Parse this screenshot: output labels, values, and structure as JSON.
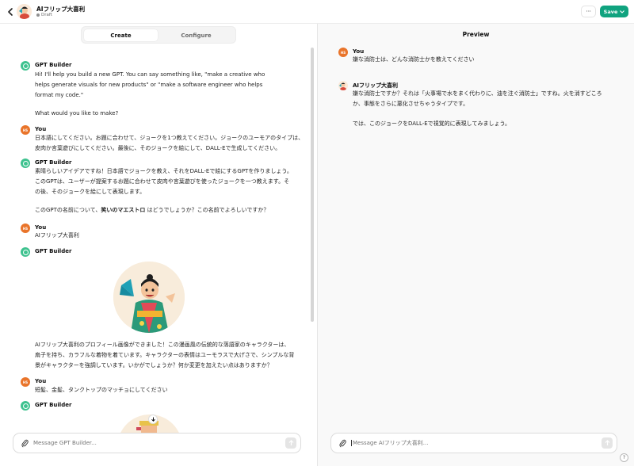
{
  "header": {
    "gpt_name": "AIフリップ大喜利",
    "status": "Draft",
    "more_label": "···",
    "save_label": "Save"
  },
  "tabs": [
    {
      "label": "Create",
      "active": true
    },
    {
      "label": "Configure",
      "active": false
    }
  ],
  "builder_chat": {
    "messages": [
      {
        "sender": "GPT Builder",
        "lines": [
          "Hi! I'll help you build a new GPT. You can say something like, \"make a creative who",
          "helps generate visuals for new products\" or \"make a software engineer who helps",
          "format my code.\""
        ],
        "extra": "What would you like to make?"
      },
      {
        "sender": "You",
        "lines": [
          "日本語にしてください。お題に合わせて、ジョークを1つ教えてください。ジョークのユーモアのタイプは、",
          "皮肉か言葉遊びにしてください。最後に、そのジョークを絵にして、DALL-Eで生成してください。"
        ]
      },
      {
        "sender": "GPT Builder",
        "lines": [
          "素晴らしいアイデアですね！日本語でジョークを教え、それをDALL-Eで絵にするGPTを作りましょう。",
          "このGPTは、ユーザーが提案するお題に合わせて皮肉や言葉遊びを使ったジョークを一つ教えます。そ",
          "の後、そのジョークを絵にして表現します。"
        ],
        "extra_prefix": "このGPTの名前について、",
        "extra_bold": "笑いのマエストロ",
        "extra_suffix": " はどうでしょうか？この名前でよろしいですか？"
      },
      {
        "sender": "You",
        "lines": [
          "AIフリップ大喜利"
        ]
      },
      {
        "sender": "GPT Builder",
        "lines": [
          "AIフリップ大喜利のプロフィール画像ができました！この漫画風の伝統的な落語家のキャラクターは、",
          "扇子を持ち、カラフルな着物を着ています。キャラクターの表情はユーモラスで大げさで、シンプルな背",
          "景がキャラクターを強調しています。いかがでしょうか？何か変更を加えたい点はありますか？"
        ]
      },
      {
        "sender": "You",
        "lines": [
          "短髪、金髪、タンクトップのマッチョにしてください"
        ]
      },
      {
        "sender": "GPT Builder",
        "lines": []
      }
    ],
    "user_avatar_initials": "HS",
    "composer_placeholder": "Message GPT Builder..."
  },
  "preview": {
    "title": "Preview",
    "messages": [
      {
        "sender": "You",
        "lines": [
          "嫌な消防士は、どんな消防士かを教えてください"
        ]
      },
      {
        "sender": "AIフリップ大喜利",
        "lines": [
          "嫌な消防士ですか？それは「火事場で水をまく代わりに、油を注ぐ消防士」ですね。火を消すどころ",
          "か、事態をさらに悪化させちゃうタイプです。"
        ],
        "extra": "では、このジョークをDALL-Eで視覚的に表現してみましょう。"
      }
    ],
    "composer_placeholder": "Message AIフリップ大喜利..."
  },
  "help_label": "?",
  "colors": {
    "save_green": "#10a37f",
    "gpt_builder_green": "#3ec28f",
    "user_orange": "#e9742a"
  }
}
